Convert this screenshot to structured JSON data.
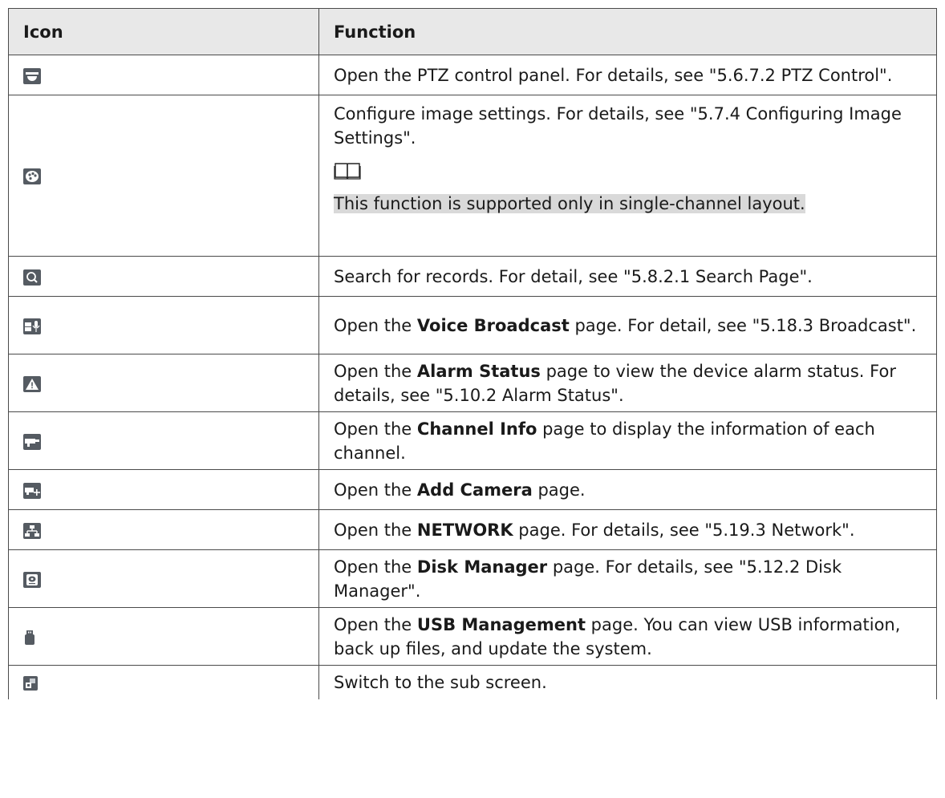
{
  "table": {
    "headers": {
      "icon": "Icon",
      "function": "Function"
    },
    "rows": [
      {
        "icon": "ptz-dome-icon",
        "before": "Open the PTZ control panel. For details, see \"5.6.7.2 PTZ Control\".",
        "bold": "",
        "after": ""
      },
      {
        "icon": "palette-icon",
        "before": "Configure image settings. For details, see \"5.7.4 Configuring Image Settings\".",
        "bold": "",
        "after": "",
        "note_icon": "book-note-icon",
        "note": "This function is supported only in single-channel layout."
      },
      {
        "icon": "search-icon",
        "before": "Search for records. For detail, see \"5.8.2.1 Search Page\".",
        "bold": "",
        "after": ""
      },
      {
        "icon": "voice-broadcast-icon",
        "before": "Open the ",
        "bold": "Voice Broadcast",
        "after": " page. For detail, see \"5.18.3 Broadcast\"."
      },
      {
        "icon": "alarm-warning-icon",
        "before": "Open the ",
        "bold": "Alarm Status",
        "after": " page to view the device alarm status. For details, see \"5.10.2 Alarm Status\"."
      },
      {
        "icon": "camera-info-icon",
        "before": "Open the ",
        "bold": "Channel Info",
        "after": " page to display the information of each channel."
      },
      {
        "icon": "add-camera-icon",
        "before": "Open the ",
        "bold": "Add Camera",
        "after": " page."
      },
      {
        "icon": "network-icon",
        "before": "Open the ",
        "bold": "NETWORK",
        "after": " page. For details, see \"5.19.3 Network\"."
      },
      {
        "icon": "disk-manager-icon",
        "before": "Open the ",
        "bold": "Disk Manager",
        "after": " page. For details, see \"5.12.2 Disk Manager\"."
      },
      {
        "icon": "usb-icon",
        "before": "Open the ",
        "bold": "USB Management",
        "after": " page. You can view USB information, back up files, and update the system."
      },
      {
        "icon": "sub-screen-icon",
        "before": "Switch to the sub screen.",
        "bold": "",
        "after": ""
      }
    ]
  }
}
